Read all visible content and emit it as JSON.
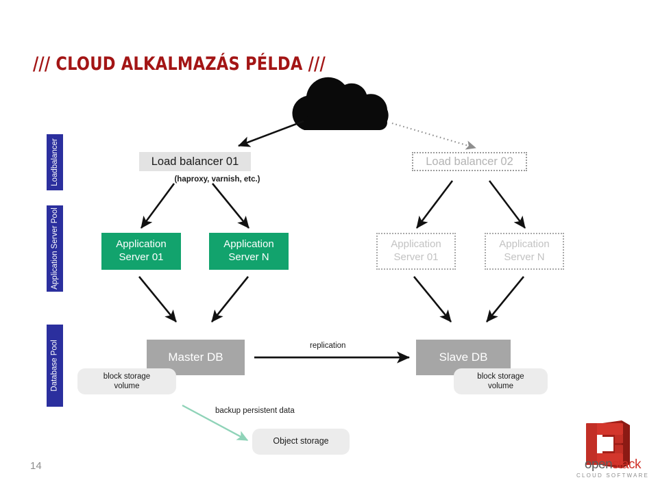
{
  "slide": {
    "title": "/// CLOUD ALKALMAZÁS PÉLDA ///",
    "page_number": "14",
    "title_color": "#a31515",
    "background": "#ffffff"
  },
  "bands": [
    {
      "label": "Loadbalancer",
      "color": "#2b2f9e"
    },
    {
      "label": "Application Server Pool",
      "color": "#2b2f9e"
    },
    {
      "label": "Database Pool",
      "color": "#2b2f9e"
    }
  ],
  "loadbalancer_tier": {
    "primary": {
      "label": "Load balancer 01",
      "state": "active",
      "fill": "#e3e3e3"
    },
    "primary_note": "(haproxy, varnish, etc.)",
    "standby": {
      "label": "Load balancer 02",
      "state": "standby",
      "border": "#9b9b9b"
    }
  },
  "application_tier": {
    "active": [
      {
        "line1": "Application",
        "line2": "Server 01",
        "fill": "#12a36d"
      },
      {
        "line1": "Application",
        "line2": "Server N",
        "fill": "#12a36d"
      }
    ],
    "standby": [
      {
        "line1": "Application",
        "line2": "Server 01",
        "border": "#a8a8a8"
      },
      {
        "line1": "Application",
        "line2": "Server N",
        "border": "#a8a8a8"
      }
    ]
  },
  "database_tier": {
    "master": {
      "label": "Master DB",
      "fill": "#a6a6a6"
    },
    "slave": {
      "label": "Slave DB",
      "fill": "#a6a6a6"
    },
    "master_volume": {
      "line1": "block storage",
      "line2": "volume",
      "fill": "#ececec"
    },
    "slave_volume": {
      "line1": "block storage",
      "line2": "volume",
      "fill": "#ececec"
    },
    "replication_label": "replication"
  },
  "storage_tier": {
    "backup_label": "backup persistent data",
    "object_storage": {
      "label": "Object storage",
      "fill": "#ececec"
    },
    "backup_arrow_color": "#8fd3b8"
  },
  "icons": {
    "cloud": "cloud-icon",
    "logo": "openstack-logo-icon"
  },
  "logo": {
    "word_part1": "open",
    "word_part2": "stack",
    "tagline": "CLOUD SOFTWARE",
    "brand_red": "#cf3027"
  }
}
